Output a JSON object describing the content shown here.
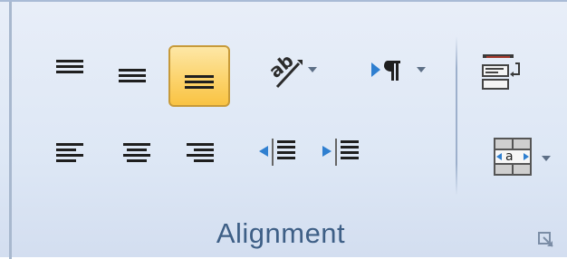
{
  "group": {
    "label": "Alignment"
  },
  "buttons": [
    {
      "id": "top-align",
      "icon": "align-top-icon",
      "state": "off"
    },
    {
      "id": "middle-align",
      "icon": "align-middle-icon",
      "state": "off"
    },
    {
      "id": "bottom-align",
      "icon": "align-bottom-icon",
      "state": "on"
    },
    {
      "id": "orientation",
      "icon": "text-orientation-icon",
      "has_dropdown": true
    },
    {
      "id": "text-direction",
      "icon": "paragraph-direction-icon",
      "has_dropdown": true
    },
    {
      "id": "wrap-text",
      "icon": "wrap-text-icon"
    },
    {
      "id": "align-left",
      "icon": "align-left-icon"
    },
    {
      "id": "center",
      "icon": "align-center-icon"
    },
    {
      "id": "align-right",
      "icon": "align-right-icon"
    },
    {
      "id": "decrease-indent",
      "icon": "decrease-indent-icon"
    },
    {
      "id": "increase-indent",
      "icon": "increase-indent-icon"
    },
    {
      "id": "merge-center",
      "icon": "merge-center-icon",
      "has_dropdown": true
    },
    {
      "id": "dialog-launcher",
      "icon": "dialog-launcher-icon"
    }
  ],
  "colors": {
    "active_fill": "#fcd36c",
    "active_border": "#c79a39",
    "label_text": "#3e5f86",
    "icon_dark": "#1f1f1f",
    "icon_blue": "#2f7fd0"
  }
}
